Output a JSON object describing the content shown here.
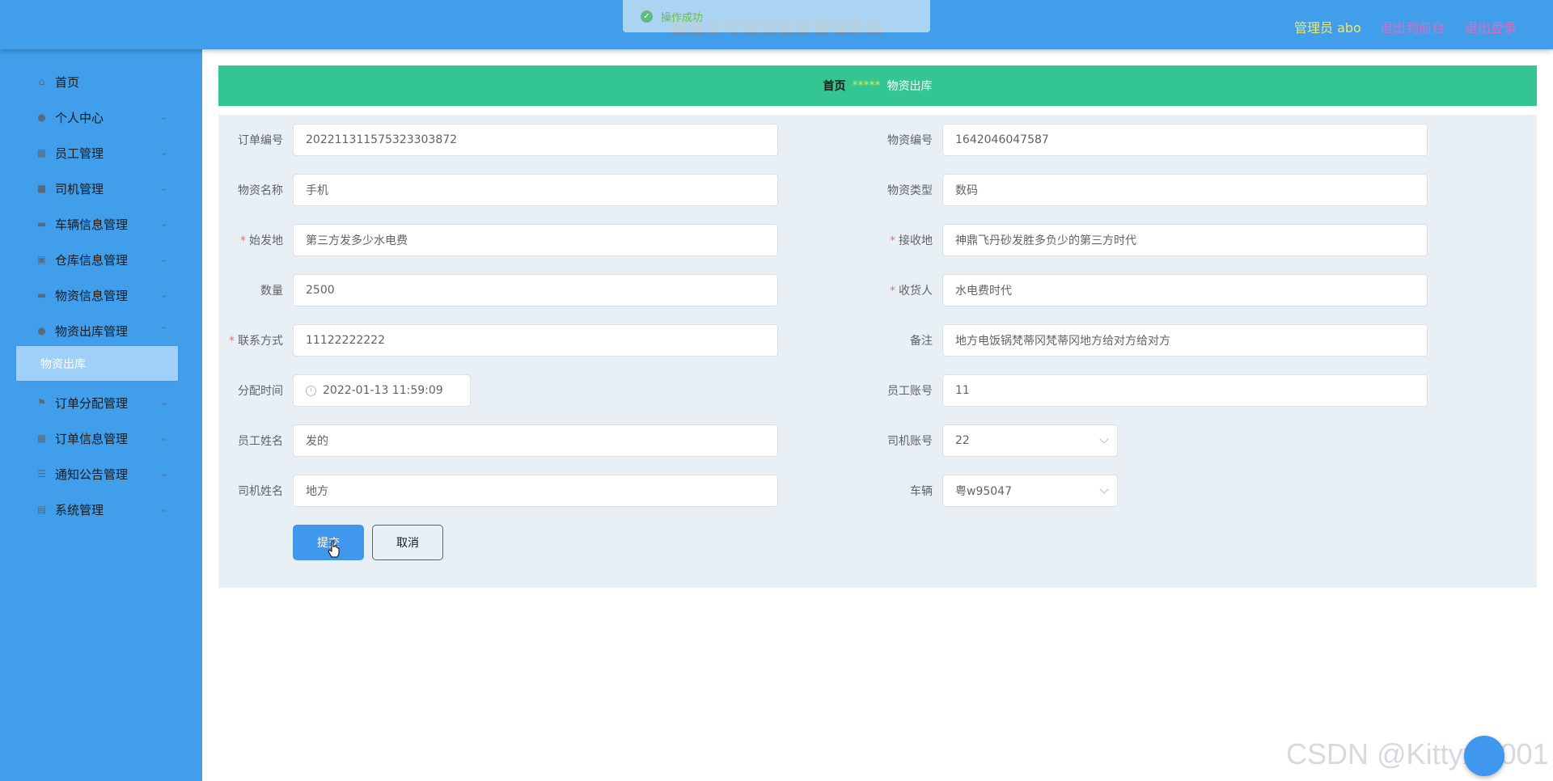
{
  "header": {
    "title": "速运公司物流信息管理系统",
    "admin": "管理员 abo",
    "to_front": "退出到前台",
    "logout": "退出登录"
  },
  "toast": {
    "message": "操作成功"
  },
  "sidebar": {
    "items": [
      {
        "label": "首页",
        "icon": "home-icon",
        "has_children": false
      },
      {
        "label": "个人中心",
        "icon": "user-icon",
        "has_children": true
      },
      {
        "label": "员工管理",
        "icon": "grid-icon",
        "has_children": true
      },
      {
        "label": "司机管理",
        "icon": "video-icon",
        "has_children": true
      },
      {
        "label": "车辆信息管理",
        "icon": "monitor-icon",
        "has_children": true
      },
      {
        "label": "仓库信息管理",
        "icon": "chart-icon",
        "has_children": true
      },
      {
        "label": "物资信息管理",
        "icon": "monitor-icon",
        "has_children": true
      },
      {
        "label": "物资出库管理",
        "icon": "user-icon",
        "has_children": true
      },
      {
        "label": "订单分配管理",
        "icon": "flag-icon",
        "has_children": true
      },
      {
        "label": "订单信息管理",
        "icon": "grid-icon",
        "has_children": true
      },
      {
        "label": "通知公告管理",
        "icon": "list-icon",
        "has_children": true
      },
      {
        "label": "系统管理",
        "icon": "clipboard-icon",
        "has_children": true
      }
    ],
    "active_sub": "物资出库"
  },
  "breadcrumb": {
    "home": "首页",
    "separator": "*****",
    "current": "物资出库"
  },
  "form": {
    "order_no": {
      "label": "订单编号",
      "value": "202211311575323303872"
    },
    "material_no": {
      "label": "物资编号",
      "value": "1642046047587"
    },
    "material_name": {
      "label": "物资名称",
      "value": "手机"
    },
    "material_type": {
      "label": "物资类型",
      "value": "数码"
    },
    "origin": {
      "label": "始发地",
      "value": "第三方发多少水电费",
      "required": "*"
    },
    "destination": {
      "label": "接收地",
      "value": "神鼎飞丹砂发胜多负少的第三方时代",
      "required": "*"
    },
    "quantity": {
      "label": "数量",
      "value": "2500"
    },
    "receiver": {
      "label": "收货人",
      "value": "水电费时代",
      "required": "*"
    },
    "contact": {
      "label": "联系方式",
      "value": "11122222222",
      "required": "*"
    },
    "remark": {
      "label": "备注",
      "value": "地方电饭锅梵蒂冈梵蒂冈地方给对方给对方"
    },
    "assign_time": {
      "label": "分配时间",
      "value": "2022-01-13 11:59:09"
    },
    "employee_account": {
      "label": "员工账号",
      "value": "11"
    },
    "employee_name": {
      "label": "员工姓名",
      "value": "发的"
    },
    "driver_account": {
      "label": "司机账号",
      "value": "22"
    },
    "driver_name": {
      "label": "司机姓名",
      "value": "地方"
    },
    "vehicle": {
      "label": "车辆",
      "value": "粤w95047"
    },
    "submit_label": "提交",
    "cancel_label": "取消"
  },
  "watermark": "CSDN @Kittyxia001",
  "colors": {
    "header_bg": "#409eea",
    "breadcrumb_bg": "#33c693",
    "panel_bg": "#e9f0f5",
    "submit_bg": "#3f98ee",
    "required": "#f56c6c"
  }
}
